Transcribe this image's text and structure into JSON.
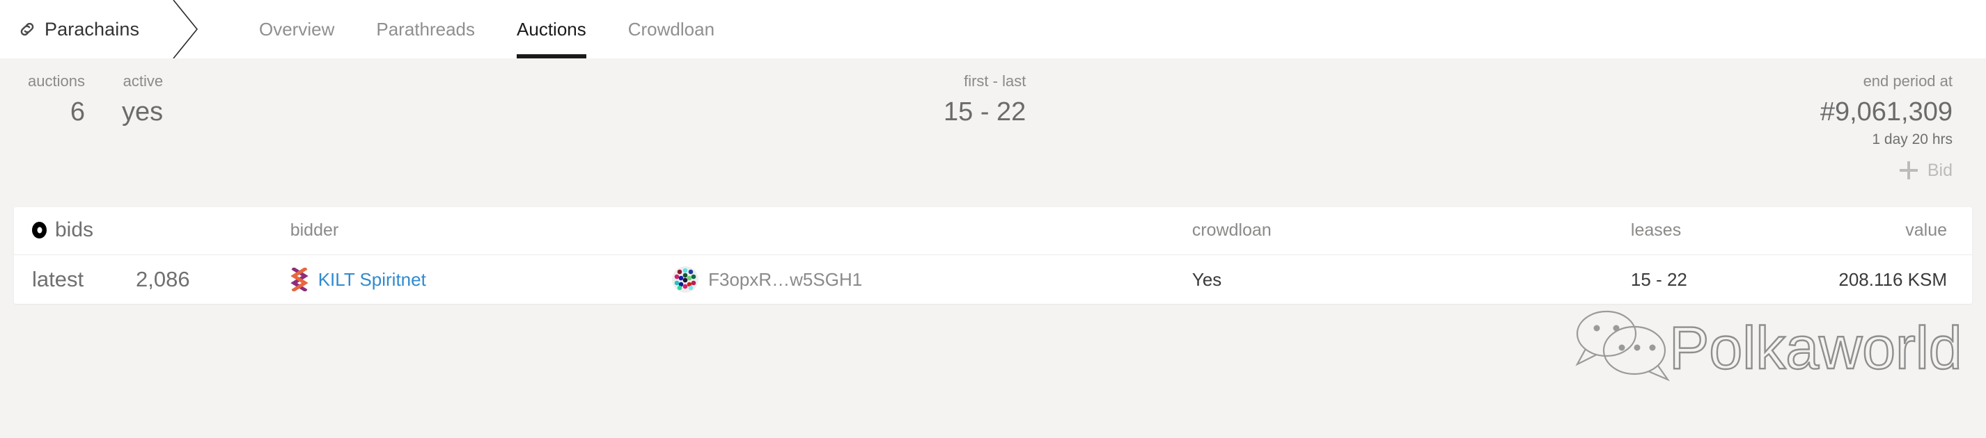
{
  "header": {
    "breadcrumb": {
      "icon": "chain-link-icon",
      "label": "Parachains"
    },
    "tabs": [
      {
        "label": "Overview",
        "active": false
      },
      {
        "label": "Parathreads",
        "active": false
      },
      {
        "label": "Auctions",
        "active": true
      },
      {
        "label": "Crowdloan",
        "active": false
      }
    ]
  },
  "stats": {
    "auctions": {
      "label": "auctions",
      "value": "6"
    },
    "active": {
      "label": "active",
      "value": "yes"
    },
    "range": {
      "label": "first - last",
      "value": "15 - 22"
    },
    "end_period": {
      "label": "end period at",
      "value": "#9,061,309",
      "sub": "1 day 20 hrs"
    }
  },
  "actions": {
    "bid_label": "Bid",
    "bid_icon": "plus-icon",
    "bid_disabled": true
  },
  "table": {
    "headers": {
      "bids": "bids",
      "bidder": "bidder",
      "crowdloan": "crowdloan",
      "leases": "leases",
      "value": "value"
    },
    "rows": [
      {
        "bid_type": "latest",
        "block": "2,086",
        "parachain_icon": "kilt-logo-icon",
        "parachain": "KILT Spiritnet",
        "account_icon": "polkadot-identicon",
        "account": "F3opxR…w5SGH1",
        "crowdloan": "Yes",
        "leases": "15 - 22",
        "value": "208.116 KSM"
      }
    ]
  },
  "watermark": {
    "text": "Polkaworld",
    "icon": "wechat-icon"
  },
  "colors": {
    "accent_link": "#2f8bd0",
    "page_bg": "#f4f3f1",
    "panel_bg": "#ffffff",
    "active_tab": "#1a1a1a",
    "muted_text": "#8c8a88",
    "kilt_purple": "#8c2d7b",
    "kilt_orange": "#e8663d"
  }
}
